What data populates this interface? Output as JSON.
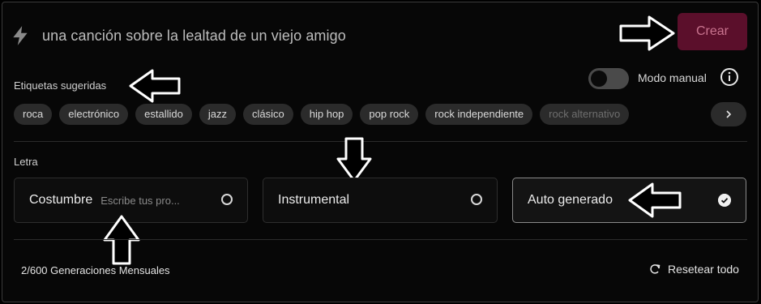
{
  "prompt": {
    "icon": "lightning-bolt-icon",
    "text": "una canción sobre la lealtad de un viejo amigo"
  },
  "create_button": {
    "label": "Crear",
    "color": "#5b0f2b"
  },
  "suggested_tags": {
    "label": "Etiquetas sugeridas",
    "items": [
      "roca",
      "electrónico",
      "estallido",
      "jazz",
      "clásico",
      "hip hop",
      "pop rock",
      "rock independiente",
      "rock alternativo"
    ]
  },
  "manual_mode": {
    "label": "Modo manual",
    "enabled": false
  },
  "lyrics": {
    "label": "Letra",
    "options": [
      {
        "title": "Costumbre",
        "placeholder": "Escribe tus pro...",
        "selected": false
      },
      {
        "title": "Instrumental",
        "selected": false
      },
      {
        "title": "Auto generado",
        "selected": true
      }
    ]
  },
  "footer": {
    "generations": "2/600 Generaciones Mensuales",
    "reset_label": "Resetear todo"
  }
}
